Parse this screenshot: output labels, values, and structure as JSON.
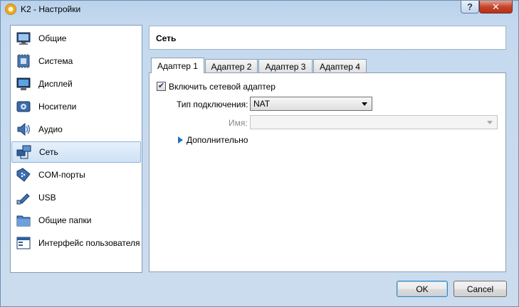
{
  "window": {
    "title": "K2 - Настройки",
    "help_label": "?",
    "close_label": "✕"
  },
  "sidebar": {
    "items": [
      {
        "label": "Общие",
        "icon": "general-monitor-icon"
      },
      {
        "label": "Система",
        "icon": "chip-icon"
      },
      {
        "label": "Дисплей",
        "icon": "display-icon"
      },
      {
        "label": "Носители",
        "icon": "storage-icon"
      },
      {
        "label": "Аудио",
        "icon": "speaker-icon"
      },
      {
        "label": "Сеть",
        "icon": "network-icon",
        "selected": true
      },
      {
        "label": "COM-порты",
        "icon": "com-port-icon"
      },
      {
        "label": "USB",
        "icon": "usb-icon"
      },
      {
        "label": "Общие папки",
        "icon": "folder-icon"
      },
      {
        "label": "Интерфейс пользователя",
        "icon": "user-interface-icon"
      }
    ]
  },
  "main": {
    "title": "Сеть",
    "tabs": [
      {
        "label": "Адаптер 1",
        "active": true
      },
      {
        "label": "Адаптер 2"
      },
      {
        "label": "Адаптер 3"
      },
      {
        "label": "Адаптер 4"
      }
    ],
    "enable_adapter": {
      "label": "Включить сетевой адаптер",
      "checked": true,
      "mark": "✔"
    },
    "attached_to": {
      "label": "Тип подключения:",
      "value": "NAT"
    },
    "name": {
      "label": "Имя:",
      "value": "",
      "disabled": true
    },
    "advanced_label": "Дополнительно"
  },
  "buttons": {
    "ok": "OK",
    "cancel": "Cancel"
  },
  "colors": {
    "window_frame": "#b9d1ea",
    "selection": "#cfe2f6",
    "close_button": "#c6452c"
  }
}
